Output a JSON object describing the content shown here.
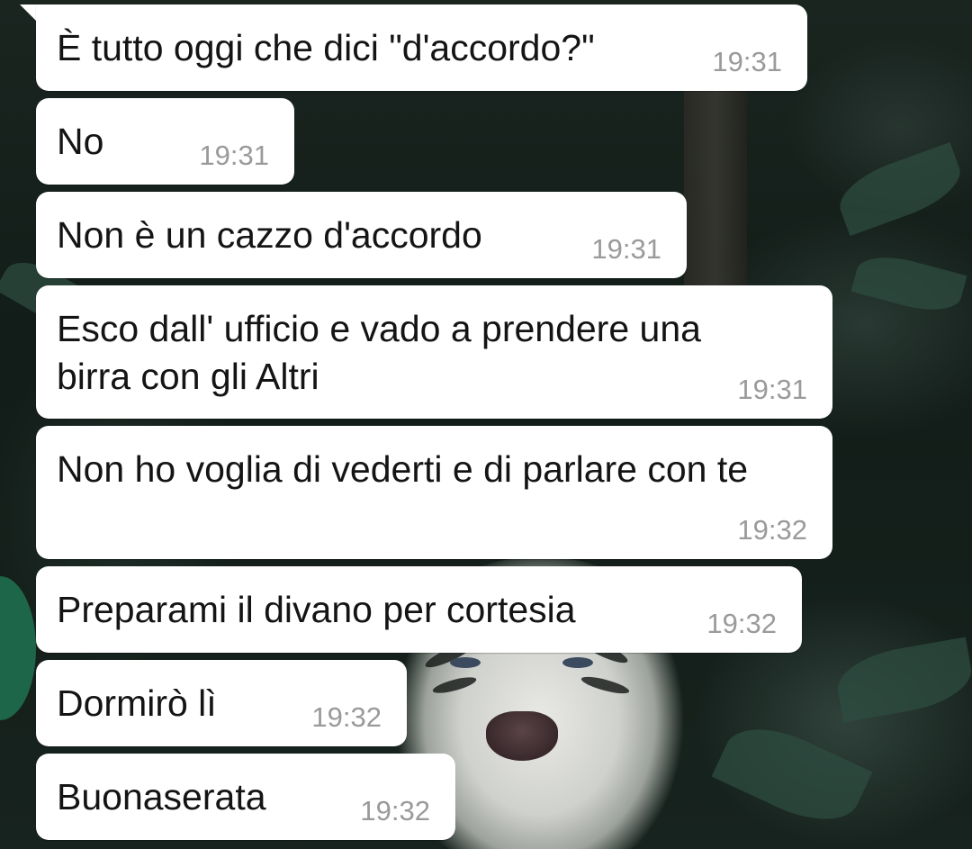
{
  "chat": {
    "messages": [
      {
        "text": "È tutto oggi che dici \"d'accordo?\"",
        "time": "19:31"
      },
      {
        "text": "No",
        "time": "19:31"
      },
      {
        "text": "Non è un cazzo d'accordo",
        "time": "19:31"
      },
      {
        "text": "Esco dall' ufficio e vado a prendere una",
        "text2": "birra con gli Altri",
        "time": "19:31"
      },
      {
        "text": "Non ho voglia di vederti e di parlare con te",
        "time": "19:32"
      },
      {
        "text": "Preparami il divano per cortesia",
        "time": "19:32"
      },
      {
        "text": "Dormirò lì",
        "time": "19:32"
      },
      {
        "text": "Buonaserata",
        "time": "19:32"
      }
    ]
  },
  "colors": {
    "bubble_incoming": "#ffffff",
    "text": "#141414",
    "timestamp": "#9a9a9a",
    "wallpaper": "#15201b"
  },
  "icons": {
    "wallpaper": "white-tiger-jungle-image"
  }
}
